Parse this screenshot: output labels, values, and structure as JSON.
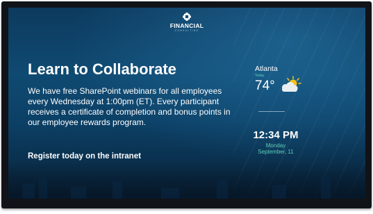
{
  "brand": {
    "name": "FINANCIAL",
    "tagline": "CONSULTING"
  },
  "announcement": {
    "headline": "Learn to Collaborate",
    "body": "We have free SharePoint webinars for all employees every Wednesday at 1:00pm (ET). Every participant receives a certificate of completion and bonus points in our employee rewards program.",
    "call_to_action": "Register today on the intranet"
  },
  "weather": {
    "city": "Atlanta",
    "period": "Today",
    "temperature": "74°",
    "condition_icon": "partly-cloudy-icon"
  },
  "clock": {
    "time": "12:34 PM",
    "day": "Monday",
    "date": "September, 11"
  },
  "colors": {
    "background": "#0f4a72",
    "accent": "#5fd0b8",
    "text": "#ffffff"
  }
}
